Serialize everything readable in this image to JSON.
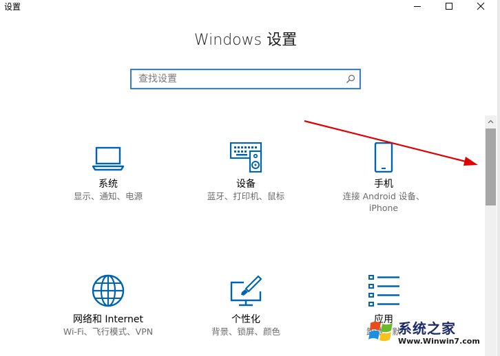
{
  "window": {
    "app_title": "设置",
    "page_title": "Windows 设置"
  },
  "search": {
    "placeholder": "查找设置",
    "value": ""
  },
  "tiles": [
    {
      "name": "系统",
      "desc1": "显示、通知、电源",
      "desc2": "",
      "icon": "laptop-icon"
    },
    {
      "name": "设备",
      "desc1": "蓝牙、打印机、鼠标",
      "desc2": "",
      "icon": "keyboard-speaker-icon"
    },
    {
      "name": "手机",
      "desc1": "连接 Android 设备、",
      "desc2": "iPhone",
      "icon": "phone-icon"
    },
    {
      "name": "网络和 Internet",
      "desc1": "Wi-Fi、飞行模式、VPN",
      "desc2": "",
      "icon": "globe-icon"
    },
    {
      "name": "个性化",
      "desc1": "背景、锁屏、颜色",
      "desc2": "",
      "icon": "paintbrush-icon"
    },
    {
      "name": "应用",
      "desc1": "卸载、默",
      "desc2": "",
      "icon": "apps-list-icon"
    }
  ],
  "watermark": {
    "text": "系统之家",
    "url": "Www.Winwin7.com"
  },
  "colors": {
    "accent": "#0063b1",
    "search_border": "#3a7fbf",
    "annotation_arrow": "#e00000"
  }
}
